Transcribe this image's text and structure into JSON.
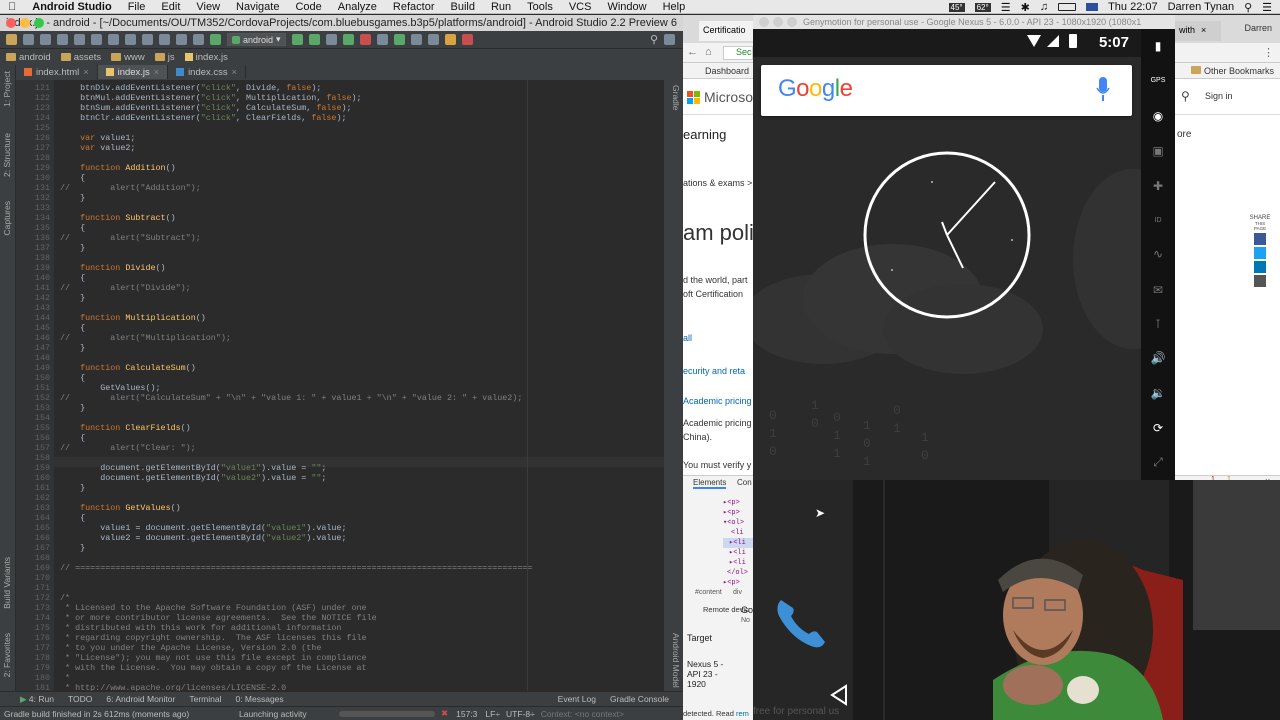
{
  "menubar": {
    "apple": "",
    "app_name": "Android Studio",
    "items": [
      "File",
      "Edit",
      "View",
      "Navigate",
      "Code",
      "Analyze",
      "Refactor",
      "Build",
      "Run",
      "Tools",
      "VCS",
      "Window",
      "Help"
    ],
    "status": {
      "temp1": "45°",
      "temp2": "62°",
      "clock": "Thu 22:07",
      "user": "Darren Tynan"
    }
  },
  "studio": {
    "window_title": "index.js - android - [~/Documents/OU/TM352/CordovaProjects/com.bluebusgames.b3p5/platforms/android] - Android Studio 2.2 Preview 6",
    "config_label": "android",
    "breadcrumbs": [
      "android",
      "assets",
      "www",
      "js",
      "index.js"
    ],
    "tabs": [
      {
        "label": "index.html",
        "kind": "html"
      },
      {
        "label": "index.js",
        "kind": "js"
      },
      {
        "label": "index.css",
        "kind": "css"
      }
    ],
    "left_tools": [
      "1: Project",
      "2: Structure",
      "Captures",
      "Build Variants",
      "2: Favorites"
    ],
    "right_tools": [
      "Gradle",
      "Android Model"
    ],
    "code_lines": [
      {
        "n": "121",
        "t": "    btnDiv.addEventListener(\"click\", Divide, false);"
      },
      {
        "n": "122",
        "t": "    btnMul.addEventListener(\"click\", Multiplication, false);"
      },
      {
        "n": "123",
        "t": "    btnSum.addEventListener(\"click\", CalculateSum, false);"
      },
      {
        "n": "124",
        "t": "    btnClr.addEventListener(\"click\", ClearFields, false);"
      },
      {
        "n": "125",
        "t": ""
      },
      {
        "n": "126",
        "t": "    var value1;"
      },
      {
        "n": "127",
        "t": "    var value2;"
      },
      {
        "n": "128",
        "t": ""
      },
      {
        "n": "129",
        "t": "    function Addition()"
      },
      {
        "n": "130",
        "t": "    {"
      },
      {
        "n": "131",
        "t": "//        alert(\"Addition\");"
      },
      {
        "n": "132",
        "t": "    }"
      },
      {
        "n": "133",
        "t": ""
      },
      {
        "n": "134",
        "t": "    function Subtract()"
      },
      {
        "n": "135",
        "t": "    {"
      },
      {
        "n": "136",
        "t": "//        alert(\"Subtract\");"
      },
      {
        "n": "137",
        "t": "    }"
      },
      {
        "n": "138",
        "t": ""
      },
      {
        "n": "139",
        "t": "    function Divide()"
      },
      {
        "n": "140",
        "t": "    {"
      },
      {
        "n": "141",
        "t": "//        alert(\"Divide\");"
      },
      {
        "n": "142",
        "t": "    }"
      },
      {
        "n": "143",
        "t": ""
      },
      {
        "n": "144",
        "t": "    function Multiplication()"
      },
      {
        "n": "145",
        "t": "    {"
      },
      {
        "n": "146",
        "t": "//        alert(\"Multiplication\");"
      },
      {
        "n": "147",
        "t": "    }"
      },
      {
        "n": "148",
        "t": ""
      },
      {
        "n": "149",
        "t": "    function CalculateSum()"
      },
      {
        "n": "150",
        "t": "    {"
      },
      {
        "n": "151",
        "t": "        GetValues();"
      },
      {
        "n": "152",
        "t": "//        alert(\"CalculateSum\" + \"\\n\" + \"value 1: \" + value1 + \"\\n\" + \"value 2: \" + value2);"
      },
      {
        "n": "153",
        "t": "    }"
      },
      {
        "n": "154",
        "t": ""
      },
      {
        "n": "155",
        "t": "    function ClearFields()"
      },
      {
        "n": "156",
        "t": "    {"
      },
      {
        "n": "157",
        "t": "//        alert(\"Clear: \");"
      },
      {
        "n": "158",
        "t": ""
      },
      {
        "n": "159",
        "t": "        document.getElementById(\"value1\").value = \"\";"
      },
      {
        "n": "160",
        "t": "        document.getElementById(\"value2\").value = \"\";"
      },
      {
        "n": "161",
        "t": "    }"
      },
      {
        "n": "162",
        "t": ""
      },
      {
        "n": "163",
        "t": "    function GetValues()"
      },
      {
        "n": "164",
        "t": "    {"
      },
      {
        "n": "165",
        "t": "        value1 = document.getElementById(\"value1\").value;"
      },
      {
        "n": "166",
        "t": "        value2 = document.getElementById(\"value2\").value;"
      },
      {
        "n": "167",
        "t": "    }"
      },
      {
        "n": "168",
        "t": ""
      },
      {
        "n": "169",
        "t": "// ==========================================================================================="
      },
      {
        "n": "170",
        "t": ""
      },
      {
        "n": "171",
        "t": ""
      },
      {
        "n": "172",
        "t": "/*"
      },
      {
        "n": "173",
        "t": " * Licensed to the Apache Software Foundation (ASF) under one"
      },
      {
        "n": "174",
        "t": " * or more contributor license agreements.  See the NOTICE file"
      },
      {
        "n": "175",
        "t": " * distributed with this work for additional information"
      },
      {
        "n": "176",
        "t": " * regarding copyright ownership.  The ASF licenses this file"
      },
      {
        "n": "177",
        "t": " * to you under the Apache License, Version 2.0 (the"
      },
      {
        "n": "178",
        "t": " * \"License\"); you may not use this file except in compliance"
      },
      {
        "n": "179",
        "t": " * with the License.  You may obtain a copy of the License at"
      },
      {
        "n": "180",
        "t": " *"
      },
      {
        "n": "181",
        "t": " * http://www.apache.org/licenses/LICENSE-2.0"
      }
    ],
    "bottom_tools": [
      "4: Run",
      "TODO",
      "6: Android Monitor",
      "Terminal",
      "0: Messages",
      "Event Log",
      "Gradle Console"
    ],
    "status_message": "Gradle build finished in 2s 612ms (moments ago)",
    "status_activity": "Launching activity",
    "cursor_pos": "157:3",
    "line_sep": "LF÷",
    "encoding": "UTF-8÷",
    "context": "Context: <no context>"
  },
  "chrome": {
    "tabs": [
      "Certificatio",
      "with"
    ],
    "tab_user": "Darren",
    "address_fragment": "Sec",
    "bookmarks": [
      "Dashboard",
      "Other Bookmarks"
    ],
    "brand": "Microsoft",
    "sign_in": "Sign in",
    "nav_fragment": "earning",
    "more_fragment": "ore",
    "breadcrumb_fragment": "ations & exams >",
    "heading_fragment": "am polic",
    "para1": "d the world, part",
    "para2": "oft Certification",
    "link_all": "all",
    "link_security": "ecurity and reta",
    "link_academic": "Academic pricing",
    "text_academic": "Academic pricing",
    "text_china": "China).",
    "text_must": "You must verify y",
    "share": [
      "SHARE",
      "THIS PAGE"
    ],
    "devtools_tabs": [
      "Elements",
      "Con"
    ],
    "devtools_breadcrumb": [
      "#content",
      "div"
    ],
    "devtools_remote": "Remote devic",
    "devtools_target": "Target",
    "devtools_device": "Nexus 5 - API 23 - 1920",
    "devtools_detected": "detected. Read ",
    "devtools_detected_link": "rem",
    "devtools_error_count": "1",
    "devtools_warn_count": "1",
    "devtools_side1": "Go",
    "devtools_side2": "No"
  },
  "genymotion": {
    "title": "Genymotion for personal use - Google Nexus 5 - 6.0.0 - API 23 - 1080x1920 (1080x1",
    "time": "5:07",
    "search_logo": "Google",
    "side_labels": [
      "GPS",
      "ID"
    ],
    "watermark": "free for personal us"
  },
  "colors": {
    "editor_bg": "#2b2b2b",
    "keyword": "#cc7832",
    "function_name": "#ffc66d",
    "string": "#6a8759",
    "comment": "#808080"
  }
}
